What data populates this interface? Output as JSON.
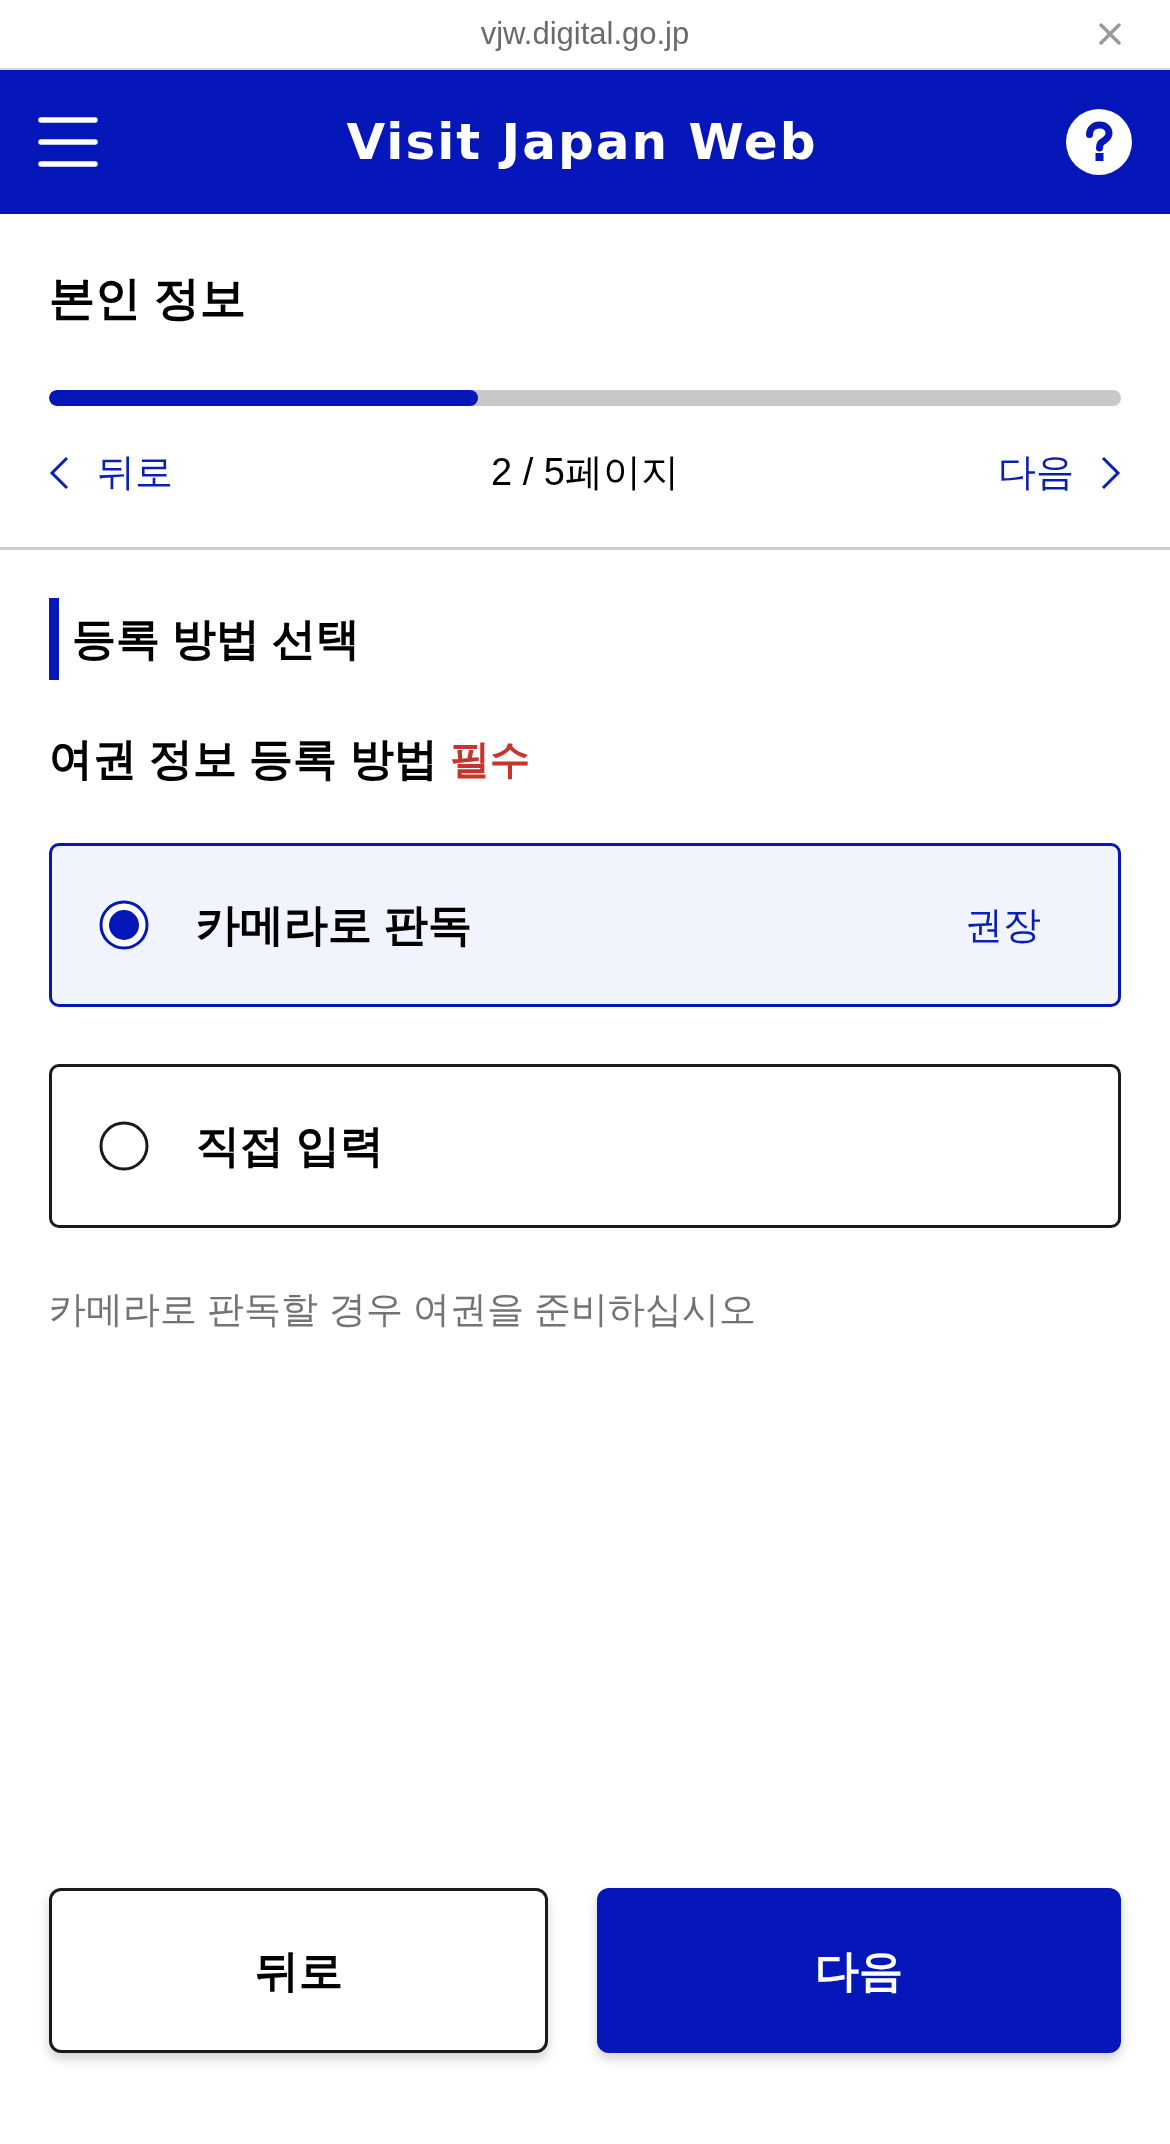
{
  "browser_bar": {
    "url": "vjw.digital.go.jp"
  },
  "header": {
    "title": "Visit Japan Web"
  },
  "page": {
    "title": "본인 정보",
    "progress": {
      "level": 0.4
    },
    "nav": {
      "back": "뒤로",
      "page_indicator": "2 / 5페이지",
      "next": "다음"
    }
  },
  "section": {
    "heading": "등록 방법 선택",
    "field": {
      "label": "여권 정보 등록 방법",
      "required": "필수",
      "options": [
        {
          "label": "카메라로 판독",
          "recommendation": "권장",
          "selected": true
        },
        {
          "label": "직접 입력",
          "selected": false
        }
      ],
      "hint": "카메라로 판독할 경우 여권을 준비하십시오"
    }
  },
  "buttons": [
    {
      "label": "뒤로",
      "kind": "secondary"
    },
    {
      "label": "다음",
      "kind": "primary"
    }
  ]
}
